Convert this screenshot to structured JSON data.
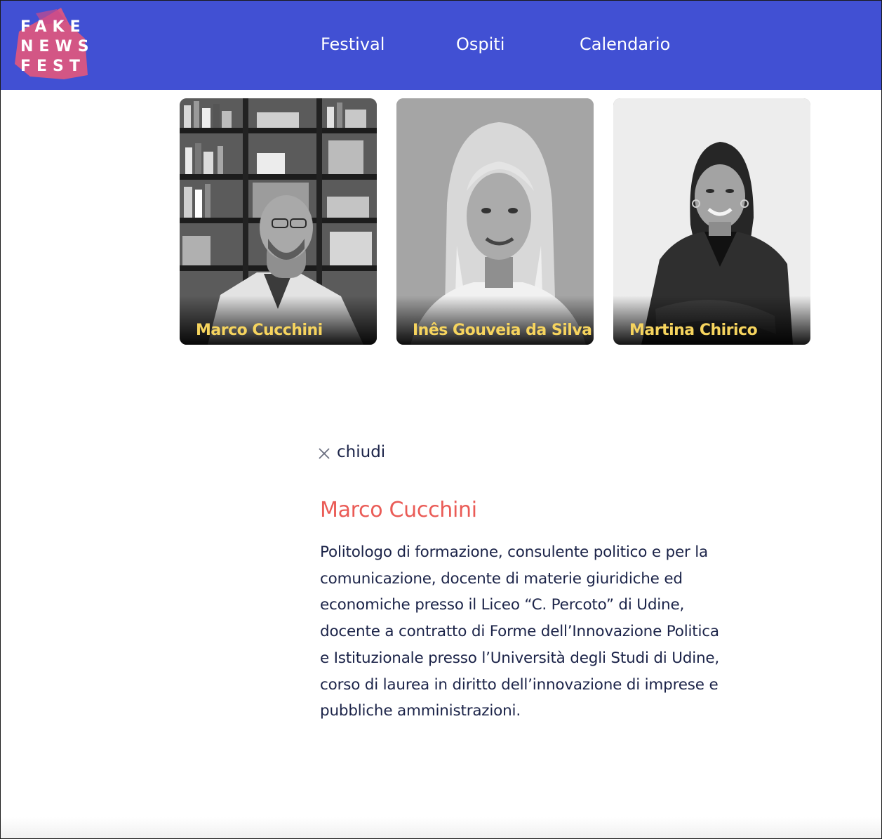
{
  "colors": {
    "header_bg": "#4150d3",
    "logo_accent": "#e0577e",
    "card_name": "#f6d45e",
    "detail_title": "#ea5b56",
    "body_text": "#1b2348"
  },
  "logo": {
    "lines": [
      "FAKE",
      "NEWS",
      "FEST"
    ]
  },
  "nav": {
    "items": [
      {
        "label": "Festival"
      },
      {
        "label": "Ospiti"
      },
      {
        "label": "Calendario"
      }
    ]
  },
  "guests": [
    {
      "name": "Marco Cucchini",
      "photo": "portrait-photo"
    },
    {
      "name": "Inês Gouveia da Silva",
      "photo": "portrait-photo"
    },
    {
      "name": "Martina Chirico",
      "photo": "portrait-photo"
    }
  ],
  "detail": {
    "close_icon": "close-icon",
    "close_label": "chiudi",
    "name": "Marco Cucchini",
    "bio": "Politologo di formazione, consulente politico e per la comunicazione, docente di materie giuridiche ed economiche presso il Liceo “C. Percoto” di Udine, docente a contratto di Forme dell’Innovazione Politica e Istituzionale presso l’Università degli Studi di Udine, corso di laurea in diritto dell’innovazione di imprese e pubbliche amministrazioni."
  }
}
